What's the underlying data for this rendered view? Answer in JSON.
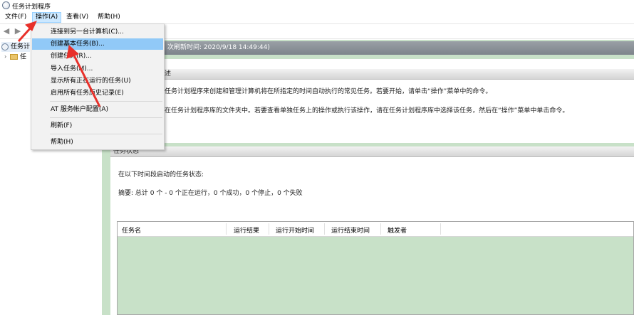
{
  "window": {
    "title": "任务计划程序"
  },
  "menubar": {
    "file": "文件(F)",
    "action": "操作(A)",
    "view": "查看(V)",
    "help": "帮助(H)"
  },
  "tree": {
    "root_label": "任务计",
    "child_label": "任"
  },
  "content": {
    "last_refresh": "次刷新时间: 2020/9/18 14:49:44)",
    "overview_head": "述",
    "overview_line1": "任务计划程序来创建和管理计算机将在所指定的时间自动执行的常见任务。若要开始，请单击“操作”菜单中的命令。",
    "overview_line2": "在任务计划程序库的文件夹中。若要查看单独任务上的操作或执行该操作，请在任务计划程序库中选择该任务，然后在“操作”菜单中单击命令。",
    "status_head": "任务状态",
    "status_intro": "在以下时间段启动的任务状态:",
    "summary": "摘要: 总计 0 个 - 0 个正在运行，0 个成功，0 个停止，0 个失败",
    "table_headers": [
      "任务名",
      "运行结果",
      "运行开始时间",
      "运行结束时间",
      "触发者"
    ]
  },
  "dropdown": {
    "items": [
      "连接到另一台计算机(C)...",
      "创建基本任务(B)...",
      "创建任务(R)...",
      "导入任务(M)...",
      "显示所有正在运行的任务(U)",
      "启用所有任务历史记录(E)",
      "AT 服务帐户配置(A)",
      "刷新(F)",
      "帮助(H)"
    ]
  },
  "colors": {
    "highlight": "#91c9f7",
    "content_bg": "#c8e1c8",
    "annotation_arrow": "#e8302a"
  }
}
